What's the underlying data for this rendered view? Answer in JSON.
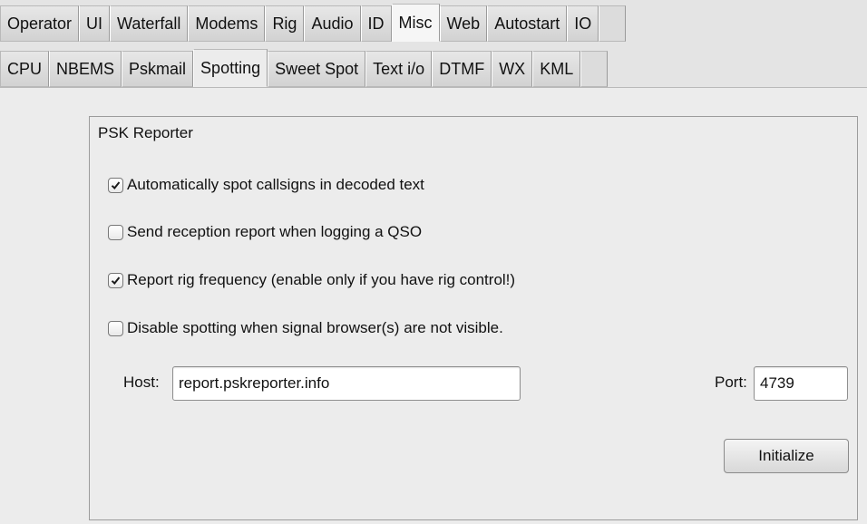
{
  "top_tabs": [
    {
      "label": "Operator",
      "active": false
    },
    {
      "label": "UI",
      "active": false
    },
    {
      "label": "Waterfall",
      "active": false
    },
    {
      "label": "Modems",
      "active": false
    },
    {
      "label": "Rig",
      "active": false
    },
    {
      "label": "Audio",
      "active": false
    },
    {
      "label": "ID",
      "active": false
    },
    {
      "label": "Misc",
      "active": true
    },
    {
      "label": "Web",
      "active": false
    },
    {
      "label": "Autostart",
      "active": false
    },
    {
      "label": "IO",
      "active": false
    }
  ],
  "sub_tabs": [
    {
      "label": "CPU",
      "active": false
    },
    {
      "label": "NBEMS",
      "active": false
    },
    {
      "label": "Pskmail",
      "active": false
    },
    {
      "label": "Spotting",
      "active": true
    },
    {
      "label": "Sweet Spot",
      "active": false
    },
    {
      "label": "Text i/o",
      "active": false
    },
    {
      "label": "DTMF",
      "active": false
    },
    {
      "label": "WX",
      "active": false
    },
    {
      "label": "KML",
      "active": false
    }
  ],
  "group": {
    "title": "PSK Reporter",
    "options": [
      {
        "label": "Automatically spot callsigns in decoded text",
        "checked": true
      },
      {
        "label": "Send reception report when logging a QSO",
        "checked": false
      },
      {
        "label": "Report rig frequency (enable only if you have rig control!)",
        "checked": true
      },
      {
        "label": "Disable spotting when signal browser(s) are not visible.",
        "checked": false
      }
    ],
    "host_label": "Host:",
    "host_value": "report.pskreporter.info",
    "port_label": "Port:",
    "port_value": "4739",
    "initialize_label": "Initialize"
  }
}
